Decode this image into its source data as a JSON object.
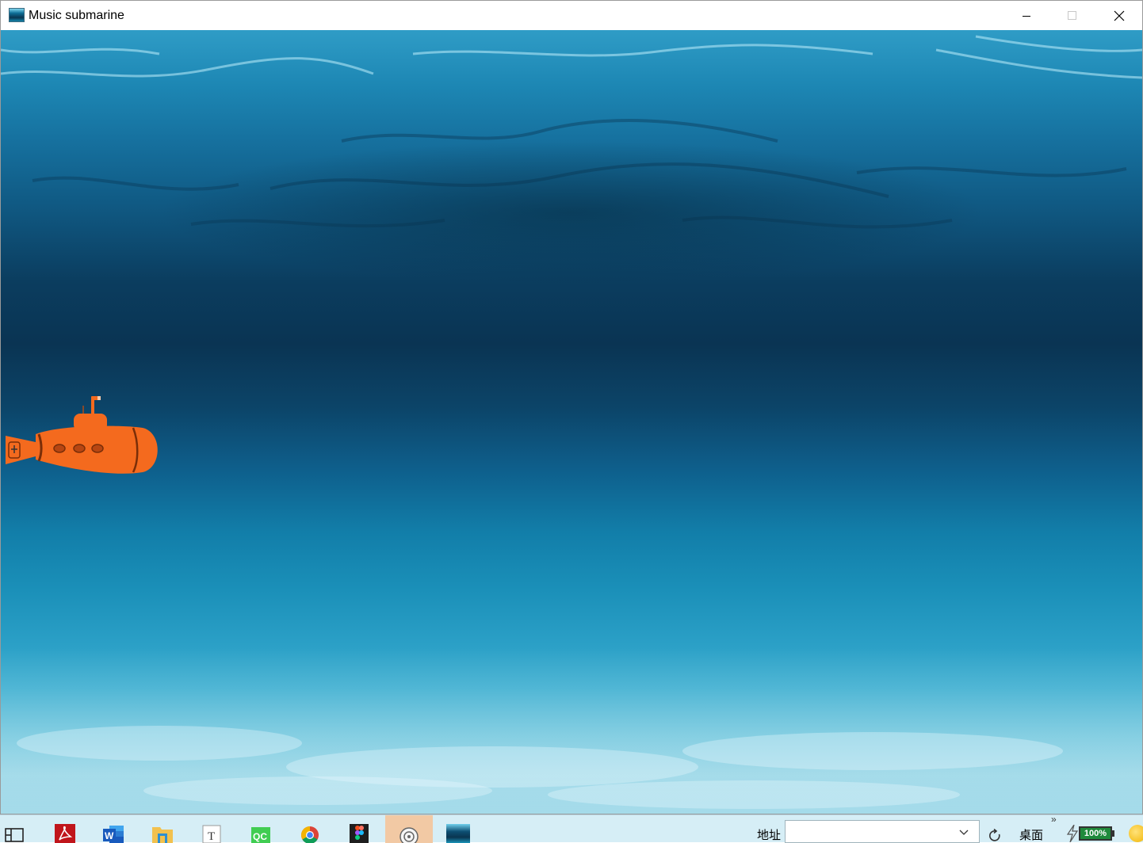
{
  "window": {
    "title": "Music submarine",
    "app_icon": "ocean-thumbnail-icon",
    "controls": [
      "minimize-icon",
      "maximize-icon",
      "close-icon"
    ]
  },
  "scene": {
    "background": "underwater-ocean",
    "sprite": "orange-submarine",
    "colors": {
      "submarine": "#f46a1e",
      "water_top": "#2f9cc6",
      "water_deep": "#0a3453",
      "water_bottom": "#7fcce0"
    }
  },
  "taskbar": {
    "apps": [
      {
        "name": "task-view-icon"
      },
      {
        "name": "adobe-acrobat-icon"
      },
      {
        "name": "word-icon"
      },
      {
        "name": "file-explorer-icon"
      },
      {
        "name": "typora-icon",
        "glyph": "T"
      },
      {
        "name": "qc-icon",
        "glyph": "QC"
      },
      {
        "name": "chrome-icon"
      },
      {
        "name": "figma-icon"
      },
      {
        "name": "settings-icon",
        "active": true
      },
      {
        "name": "music-submarine-icon"
      }
    ],
    "address_label": "地址",
    "address_value": "",
    "desktop_label": "桌面",
    "overflow": "»",
    "battery_percent": "100%"
  }
}
